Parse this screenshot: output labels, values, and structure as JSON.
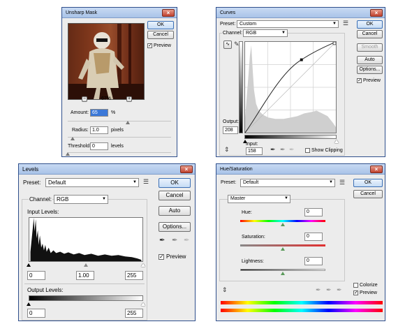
{
  "unsharp": {
    "title": "Unsharp Mask",
    "close": "×",
    "zoom": "67%",
    "zoom_out": "−",
    "zoom_in": "+",
    "ok": "OK",
    "cancel": "Cancel",
    "preview": "Preview",
    "preview_checked": true,
    "amount_label": "Amount:",
    "amount_value": "65",
    "amount_unit": "%",
    "amount_slider": 0.58,
    "radius_label": "Radius:",
    "radius_value": "1.0",
    "radius_unit": "pixels",
    "radius_slider": 0.05,
    "threshold_label": "Threshold:",
    "threshold_value": "0",
    "threshold_unit": "levels",
    "threshold_slider": 0.0
  },
  "curves": {
    "title": "Curves",
    "close": "×",
    "preset_label": "Preset:",
    "preset_value": "Custom",
    "channel_label": "Channel:",
    "channel_value": "RGB",
    "ok": "OK",
    "cancel": "Cancel",
    "smooth": "Smooth",
    "auto": "Auto",
    "options": "Options...",
    "preview": "Preview",
    "preview_checked": true,
    "output_label": "Output:",
    "output_value": "208",
    "input_label": "Input:",
    "input_value": "158",
    "show_clipping": "Show Clipping",
    "show_clipping_checked": false
  },
  "levels": {
    "title": "Levels",
    "close": "×",
    "preset_label": "Preset:",
    "preset_value": "Default",
    "channel_label": "Channel:",
    "channel_value": "RGB",
    "input_levels_label": "Input Levels:",
    "input_black": "0",
    "input_gamma": "1.00",
    "input_white": "255",
    "output_levels_label": "Output Levels:",
    "output_black": "0",
    "output_white": "255",
    "ok": "OK",
    "cancel": "Cancel",
    "auto": "Auto",
    "options": "Options...",
    "preview": "Preview",
    "preview_checked": true
  },
  "huesat": {
    "title": "Hue/Saturation",
    "close": "×",
    "preset_label": "Preset:",
    "preset_value": "Default",
    "edit_value": "Master",
    "hue_label": "Hue:",
    "hue_value": "0",
    "saturation_label": "Saturation:",
    "saturation_value": "0",
    "lightness_label": "Lightness:",
    "lightness_value": "0",
    "ok": "OK",
    "cancel": "Cancel",
    "colorize": "Colorize",
    "colorize_checked": false,
    "preview": "Preview",
    "preview_checked": true
  },
  "colors": {
    "title_bar": "#a9c3e8",
    "close_button": "#c0412e",
    "dialog_bg": "#ececec",
    "default_button": "#c6dcf5"
  },
  "icons": [
    "close-icon",
    "preset-menu-icon",
    "curve-point-tool-icon",
    "pencil-tool-icon",
    "on-image-adjust-icon",
    "black-eyedropper-icon",
    "gray-eyedropper-icon",
    "white-eyedropper-icon",
    "dropdown-arrow-icon"
  ]
}
